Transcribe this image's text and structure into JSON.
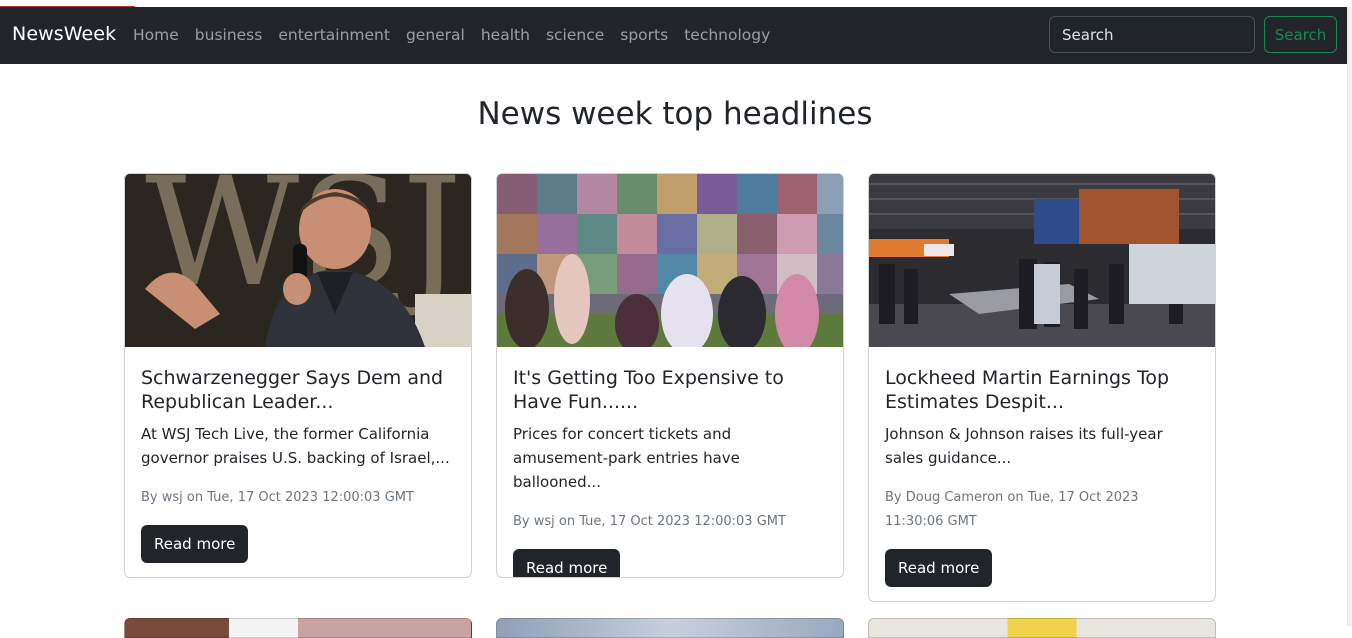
{
  "navbar": {
    "brand": "NewsWeek",
    "links": [
      "Home",
      "business",
      "entertainment",
      "general",
      "health",
      "science",
      "sports",
      "technology"
    ],
    "search_placeholder": "Search",
    "search_button": "Search"
  },
  "page_title": "News week top headlines",
  "cards": [
    {
      "title": "Schwarzenegger Says Dem and Republican Leader...",
      "description": "At WSJ Tech Live, the former California governor praises U.S. backing of Israel,...",
      "meta": "By wsj on Tue, 17 Oct 2023 12:00:03 GMT",
      "button": "Read more",
      "image": "man-speaking-microphone-photo"
    },
    {
      "title": "It's Getting Too Expensive to Have Fun......",
      "description": "Prices for concert tickets and amusement-park entries have ballooned...",
      "meta": "By wsj on Tue, 17 Oct 2023 12:00:03 GMT",
      "button": "Read more",
      "image": "fans-photo-wall-photo"
    },
    {
      "title": "Lockheed Martin Earnings Top Estimates Despit...",
      "description": "Johnson & Johnson raises its full-year sales guidance...",
      "meta": "By Doug Cameron on Tue, 17 Oct 2023 11:30:06 GMT",
      "button": "Read more",
      "image": "aerospace-expo-photo"
    }
  ],
  "colors": {
    "navbar_bg": "#212529",
    "search_accent": "#198754",
    "button_dark": "#212529"
  }
}
